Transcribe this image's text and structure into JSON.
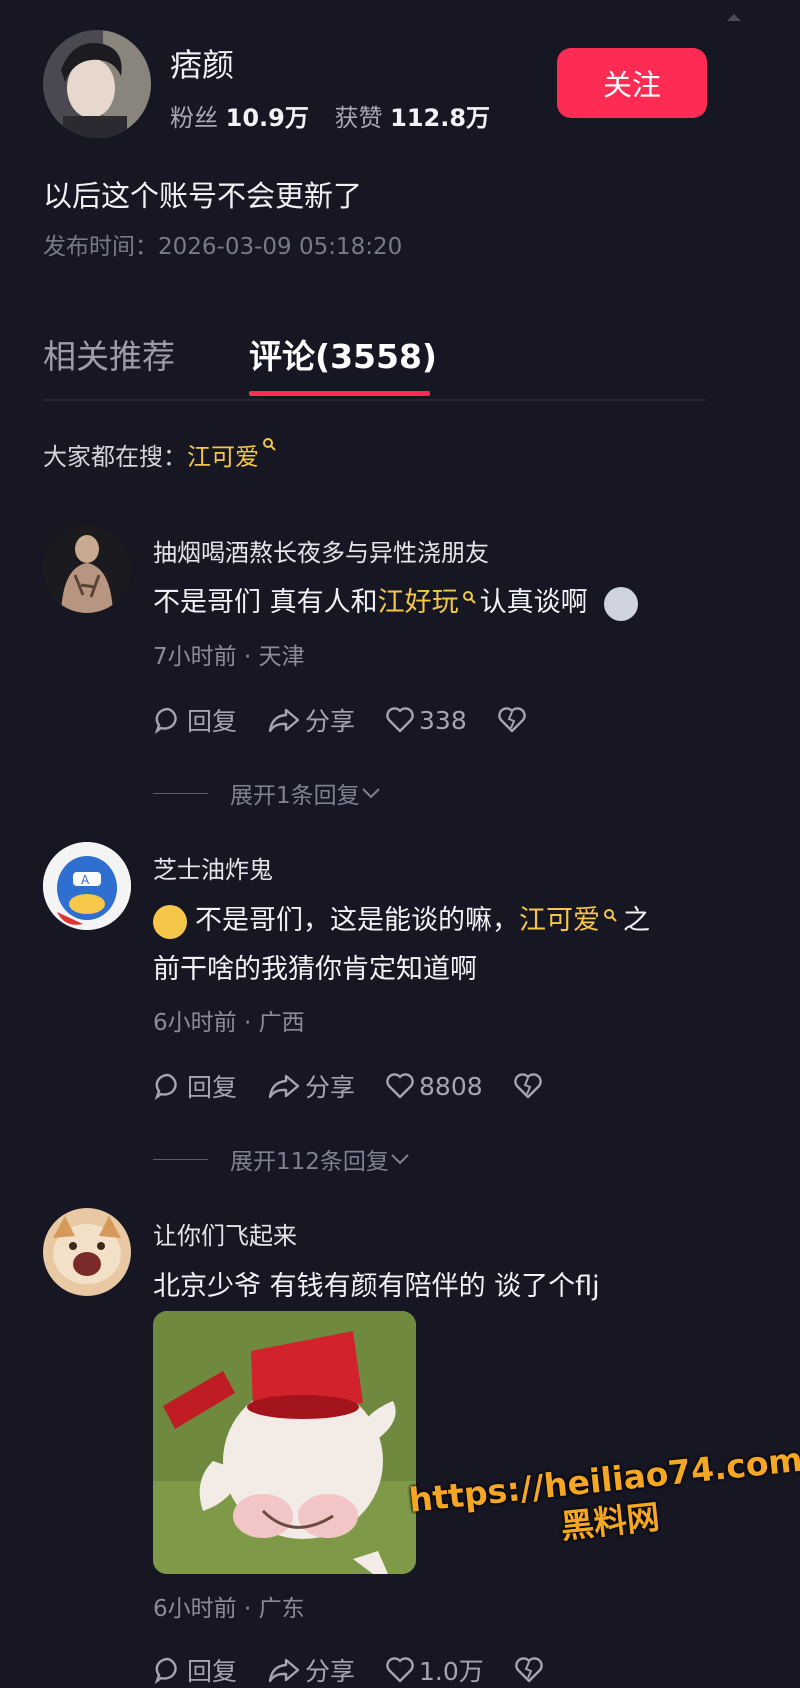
{
  "author": {
    "name": "痞颜",
    "fans_label": "粉丝",
    "fans_count": "10.9万",
    "likes_label": "获赞",
    "likes_count": "112.8万",
    "follow_label": "关注"
  },
  "post": {
    "description": "以后这个账号不会更新了",
    "publish_time": "发布时间：2026-03-09 05:18:20"
  },
  "tabs": [
    {
      "label": "相关推荐",
      "active": false
    },
    {
      "label": "评论(3558)",
      "active": true
    }
  ],
  "search_hint": {
    "label": "大家都在搜：",
    "term": "江可爱"
  },
  "comments": [
    {
      "user": "抽烟喝酒熬长夜多与异性浇朋友",
      "text_before": "不是哥们 真有人和",
      "highlight": "江好玩",
      "text_after": "认真谈啊",
      "meta": "7小时前 · 天津",
      "reply_label": "回复",
      "share_label": "分享",
      "likes": "338",
      "expand_label": "展开1条回复"
    },
    {
      "user": "芝士油炸鬼",
      "text_before": "不是哥们，这是能谈的嘛，",
      "highlight": "江可爱",
      "text_after": "之",
      "text_line2": "前干啥的我猜你肯定知道啊",
      "meta": "6小时前 · 广西",
      "reply_label": "回复",
      "share_label": "分享",
      "likes": "8808",
      "expand_label": "展开112条回复"
    },
    {
      "user": "让你们飞起来",
      "text": "北京少爷 有钱有颜有陪伴的 谈了个flj",
      "meta": "6小时前 · 广东",
      "reply_label": "回复",
      "share_label": "分享",
      "likes": "1.0万"
    }
  ],
  "watermark": {
    "url": "https://heiliao74.com",
    "name": "黑料网"
  },
  "colors": {
    "background": "#161723",
    "accent": "#fe2c55",
    "highlight": "#f5c64a"
  }
}
